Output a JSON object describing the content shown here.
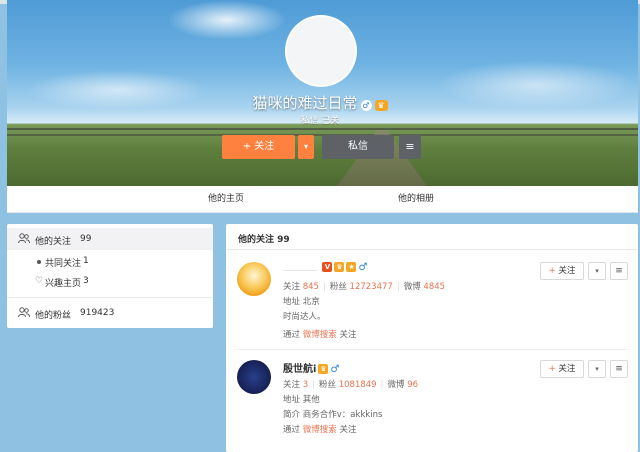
{
  "profile": {
    "nickname": "猫咪的难过日常",
    "gender_symbol": "♂",
    "level_badge": "♛",
    "meta": "私信 已关",
    "follow_label": "关注",
    "follow_plus": "+",
    "follow_dropdown": "▾",
    "message_label": "私信",
    "more_label": "≡"
  },
  "tabs": [
    {
      "label": "他的主页"
    },
    {
      "label": "他的相册"
    }
  ],
  "sidebar": {
    "following": {
      "label": "他的关注",
      "count": "99"
    },
    "common": {
      "label": "共同关注",
      "count": "1"
    },
    "interest": {
      "label": "兴趣主页",
      "count": "3"
    },
    "fans": {
      "label": "他的粉丝",
      "count": "919423"
    }
  },
  "main": {
    "title": "他的关注 99",
    "follow_btn": "关注",
    "follow_plus": "+",
    "dropdown": "▾",
    "menu": "≡",
    "users": [
      {
        "name": "",
        "v_badge": "V",
        "follow_label": "关注",
        "follow_count": "845",
        "fans_label": "粉丝",
        "fans_count": "12723477",
        "weibo_label": "微博",
        "weibo_count": "4845",
        "address_label": "地址",
        "address": "北京",
        "intro": "时尚达人。",
        "via_prefix": "通过",
        "via_link": "微博搜索",
        "via_suffix": "关注"
      },
      {
        "name": "殷世航i",
        "follow_label": "关注",
        "follow_count": "3",
        "fans_label": "粉丝",
        "fans_count": "1081849",
        "weibo_label": "微博",
        "weibo_count": "96",
        "address_label": "地址",
        "address": "其他",
        "intro_label": "简介",
        "intro": "商务合作v：akkkins",
        "via_prefix": "通过",
        "via_link": "微博搜索",
        "via_suffix": "关注"
      }
    ]
  },
  "colors": {
    "accent_orange": "#ff8140",
    "link_orange": "#eb7350",
    "page_bg": "#8fc1e3",
    "dark_button": "#5e6166"
  }
}
